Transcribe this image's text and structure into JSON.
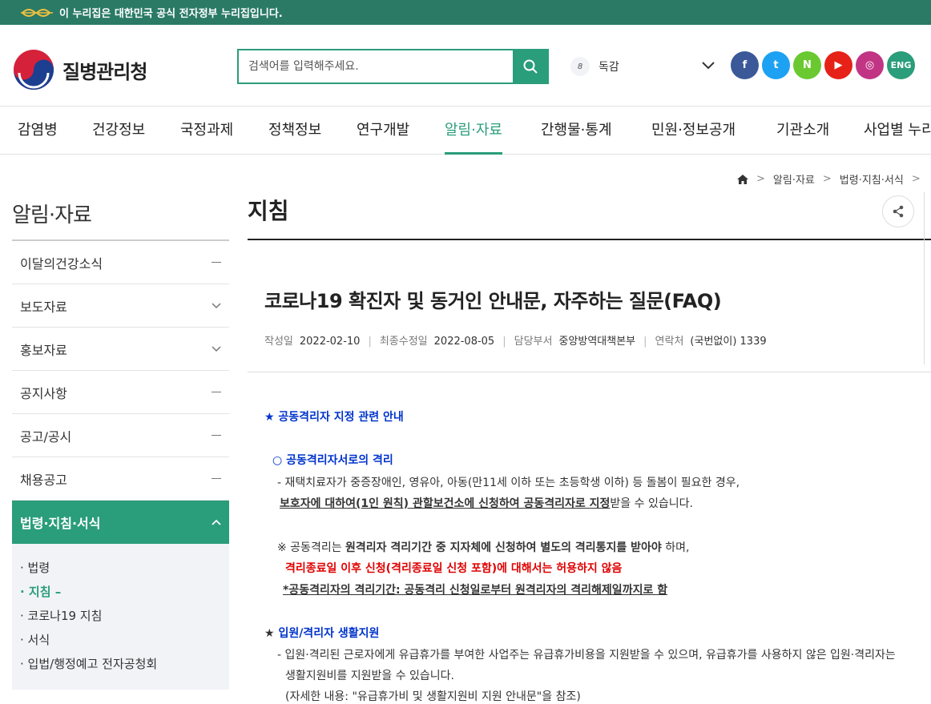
{
  "gov_banner": {
    "text": "이 누리집은 대한민국 공식 전자정부 누리집입니다."
  },
  "header": {
    "logo_text": "질병관리청",
    "search_placeholder": "검색어를 입력해주세요.",
    "alert_badge": "8",
    "alert_label": "독감",
    "sns": [
      {
        "icon": "facebook-icon",
        "glyph": "f",
        "color": "#3b5998"
      },
      {
        "icon": "twitter-icon",
        "glyph": "t",
        "color": "#1da1f2"
      },
      {
        "icon": "naver-blog-icon",
        "glyph": "N",
        "color": "#6ac931"
      },
      {
        "icon": "youtube-icon",
        "glyph": "▶",
        "color": "#e62117"
      },
      {
        "icon": "instagram-icon",
        "glyph": "◎",
        "color": "#c13584"
      },
      {
        "icon": "eng-icon",
        "glyph": "ENG",
        "color": "#2a9d7a"
      }
    ]
  },
  "gnb": [
    "감염병",
    "건강정보",
    "국정과제",
    "정책정보",
    "연구개발",
    "알림·자료",
    "간행물·통계",
    "민원·정보공개",
    "기관소개",
    "사업별 누리집"
  ],
  "breadcrumb": [
    "알림·자료",
    "법령·지침·서식"
  ],
  "sidebar": {
    "title": "알림·자료",
    "items": [
      "이달의건강소식",
      "보도자료",
      "홍보자료",
      "공지사항",
      "공고/공시",
      "채용공고"
    ],
    "active": "법령·지침·서식",
    "sub": [
      "법령",
      "지침 –",
      "코로나19 지침",
      "서식",
      "입법/행정예고 전자공청회"
    ]
  },
  "content": {
    "page_title": "지침",
    "article_title": "코로나19 확진자 및 동거인 안내문, 자주하는 질문(FAQ)",
    "meta": {
      "written_label": "작성일",
      "written": "2022-02-10",
      "modified_label": "최종수정일",
      "modified": "2022-08-05",
      "dept_label": "담당부서",
      "dept": "중앙방역대책본부",
      "contact_label": "연락처",
      "contact": "(국번없이) 1339"
    },
    "body": {
      "h1": "★ 공동격리자 지정 관련 안내",
      "h1a": "○ 공동격리자서로의 격리",
      "p1": "- 재택치료자가 중증장애인, 영유아, 아동(만11세 이하 또는 초등학생 이하) 등 돌봄이 필요한 경우,",
      "p2u": "보호자에 대하여(1인 원칙) 관할보건소에 신청하여 공동격리자로 지정",
      "p2": "받을 수 있습니다.",
      "n1a": "※ 공동격리는 ",
      "n1b": "원격리자 격리기간 중 지자체에 신청하여 별도의 격리통지를 받아야",
      "n1c": " 하며,",
      "n2": "격리종료일 이후 신청(격리종료일 신청 포함)에 대해서는 허용하지 않음",
      "n3": "*공동격리자의 격리기간: 공동격리 신청일로부터 원격리자의 격리해제일까지로 함",
      "h2": "입원/격리자 생활지원",
      "p3": "- 입원·격리된 근로자에게 유급휴가를 부여한 사업주는 유급휴가비용을 지원받을 수 있으며, 유급휴가를 사용하지 않은 입원·격리자는",
      "p4": "생활지원비를 지원받을 수 있습니다.",
      "p5": "(자세한 내용: \"유급휴가비 및 생활지원비 지원 안내문\"을 참조)"
    }
  }
}
